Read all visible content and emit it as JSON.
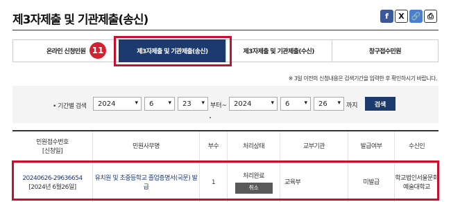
{
  "page": {
    "title": "제3자제출 및 기관제출(송신)"
  },
  "share": {
    "facebook": "f",
    "x": "X",
    "link": "🔗",
    "print": "⎙"
  },
  "tabs": [
    "온라인 신청민원",
    "제3자제출 및 기관제출(송신)",
    "제3자제출 및 기관제출(수신)",
    "창구접수민원"
  ],
  "badge": "11",
  "note": "※ 3일 이전의 신청내용은 검색기간을 입력한 후 확인하시기 바랍니다.",
  "search": {
    "label": "기간별 검색",
    "from_year": "2024",
    "from_month": "6",
    "from_day": "23",
    "mid_text": "부터~",
    "to_year": "2024",
    "to_month": "6",
    "to_day": "26",
    "end_text": "까지",
    "button": "검색"
  },
  "table": {
    "headers": [
      "민원접수번호\n[신청일]",
      "민원사무명",
      "부수",
      "처리상태",
      "교부기관",
      "발급여부",
      "수신인"
    ],
    "row": {
      "receipt_no": "20240626-29636654",
      "date": "[2024년 6월26일]",
      "service": "유치원 및 초중등학교 졸업증명서(국문) 발급",
      "copies": "1",
      "status": "처리완료",
      "cancel": "취소",
      "agency": "교육부",
      "issued": "미발급",
      "recipient": "학교법인서울문화예술대학교"
    }
  }
}
